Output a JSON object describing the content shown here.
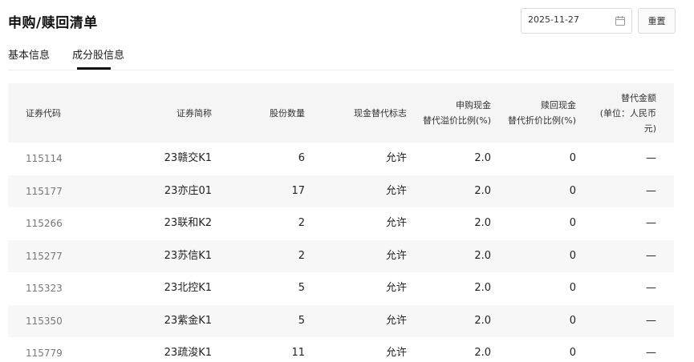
{
  "page": {
    "title": "申购/赎回清单",
    "date_value": "2025-11-27",
    "reset_label": "重置"
  },
  "tabs": [
    {
      "label": "基本信息",
      "active": false
    },
    {
      "label": "成分股信息",
      "active": true
    }
  ],
  "table": {
    "headers": {
      "code": "证券代码",
      "name": "证券简称",
      "qty": "股份数量",
      "flag": "现金替代标志",
      "sub_pct_1": "申购现金",
      "sub_pct_2": "替代溢价比例(%)",
      "red_pct_1": "赎回现金",
      "red_pct_2": "替代折价比例(%)",
      "amt_1": "替代金额",
      "amt_2": "(单位：人民币",
      "amt_3": "元)"
    },
    "rows": [
      {
        "code": "115114",
        "name": "23赣交K1",
        "qty": "6",
        "flag": "允许",
        "sub_pct": "2.0",
        "red_pct": "0",
        "amt": "—"
      },
      {
        "code": "115177",
        "name": "23亦庄01",
        "qty": "17",
        "flag": "允许",
        "sub_pct": "2.0",
        "red_pct": "0",
        "amt": "—"
      },
      {
        "code": "115266",
        "name": "23联和K2",
        "qty": "2",
        "flag": "允许",
        "sub_pct": "2.0",
        "red_pct": "0",
        "amt": "—"
      },
      {
        "code": "115277",
        "name": "23苏信K1",
        "qty": "2",
        "flag": "允许",
        "sub_pct": "2.0",
        "red_pct": "0",
        "amt": "—"
      },
      {
        "code": "115323",
        "name": "23北控K1",
        "qty": "5",
        "flag": "允许",
        "sub_pct": "2.0",
        "red_pct": "0",
        "amt": "—"
      },
      {
        "code": "115350",
        "name": "23紫金K1",
        "qty": "5",
        "flag": "允许",
        "sub_pct": "2.0",
        "red_pct": "0",
        "amt": "—"
      },
      {
        "code": "115779",
        "name": "23疏浚K1",
        "qty": "11",
        "flag": "允许",
        "sub_pct": "2.0",
        "red_pct": "0",
        "amt": "—"
      }
    ]
  }
}
